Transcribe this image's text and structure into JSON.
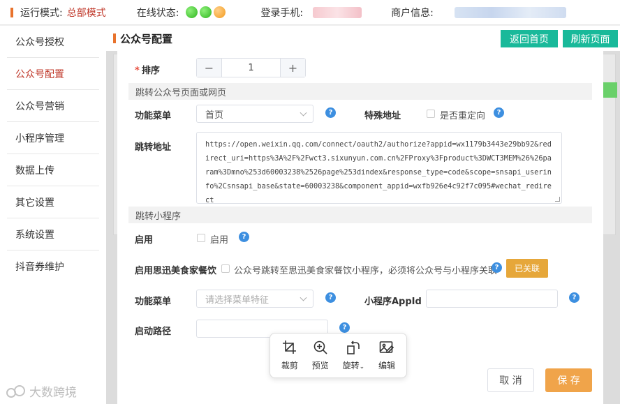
{
  "topbar": {
    "run_mode_label": "运行模式:",
    "run_mode_value": "总部模式",
    "online_status_label": "在线状态:",
    "login_phone_label": "登录手机:",
    "merchant_info_label": "商户信息:",
    "status_colors": [
      "#2fb51f",
      "#2fb51f",
      "#f39a1b"
    ]
  },
  "sidebar": {
    "items": [
      {
        "label": "公众号授权"
      },
      {
        "label": "公众号配置"
      },
      {
        "label": "公众号营销"
      },
      {
        "label": "小程序管理"
      },
      {
        "label": "数据上传"
      },
      {
        "label": "其它设置"
      },
      {
        "label": "系统设置"
      },
      {
        "label": "抖音券维护"
      }
    ],
    "active_index": 1,
    "watermark": "大数跨境"
  },
  "header": {
    "title": "公众号配置",
    "back_home": "返回首页",
    "refresh": "刷新页面"
  },
  "form": {
    "sort_label": "排序",
    "sort_value": "1",
    "minus": "−",
    "plus": "+",
    "section_page": "跳转公众号页面或网页",
    "menu_label": "功能菜单",
    "menu_value": "首页",
    "special_addr_label": "特殊地址",
    "redirect_checkbox": "是否重定向",
    "jump_addr_label": "跳转地址",
    "jump_addr_value": "https://open.weixin.qq.com/connect/oauth2/authorize?appid=wx1179b3443e29bb92&redirect_uri=https%3A%2F%2Fwct3.sixunyun.com.cn%2FProxy%3Fproduct%3DWCT3MEM%26%26param%3Dmno%253d60003238%2526page%253dindex&response_type=code&scope=snsapi_userinfo%2Csnsapi_base&state=60003238&component_appid=wxfb926e4c92f7c095#wechat_redirect",
    "section_mini": "跳转小程序",
    "enable_label": "启用",
    "enable_checkbox": "启用",
    "enable_sixun_label": "启用思迅美食家餐饮",
    "enable_sixun_text": "公众号跳转至思迅美食家餐饮小程序，必须将公众号与小程序关联",
    "linked_button": "已关联",
    "menu2_label": "功能菜单",
    "menu2_placeholder": "请选择菜单特征",
    "appid_label": "小程序AppId",
    "appid_value": "",
    "start_path_label": "启动路径",
    "start_path_value": "",
    "cancel": "取 消",
    "save": "保 存"
  },
  "image_toolbar": {
    "crop": "裁剪",
    "preview": "预览",
    "rotate": "旋转",
    "edit": "编辑"
  }
}
